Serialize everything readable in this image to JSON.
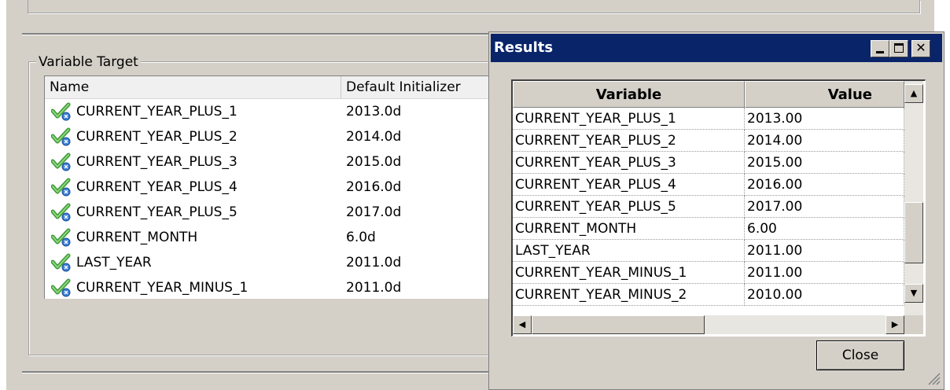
{
  "variable_target": {
    "title": "Variable Target",
    "columns": [
      "Name",
      "Default Initializer"
    ],
    "rows": [
      {
        "name": "CURRENT_YEAR_PLUS_1",
        "init": "2013.0d"
      },
      {
        "name": "CURRENT_YEAR_PLUS_2",
        "init": "2014.0d"
      },
      {
        "name": "CURRENT_YEAR_PLUS_3",
        "init": "2015.0d"
      },
      {
        "name": "CURRENT_YEAR_PLUS_4",
        "init": "2016.0d"
      },
      {
        "name": "CURRENT_YEAR_PLUS_5",
        "init": "2017.0d"
      },
      {
        "name": "CURRENT_MONTH",
        "init": "6.0d"
      },
      {
        "name": "LAST_YEAR",
        "init": "2011.0d"
      },
      {
        "name": "CURRENT_YEAR_MINUS_1",
        "init": "2011.0d"
      }
    ],
    "row_icon": "variable-check-icon"
  },
  "results": {
    "title": "Results",
    "columns": [
      "Variable",
      "Value"
    ],
    "rows": [
      {
        "variable": "CURRENT_YEAR_PLUS_1",
        "value": "2013.00"
      },
      {
        "variable": "CURRENT_YEAR_PLUS_2",
        "value": "2014.00"
      },
      {
        "variable": "CURRENT_YEAR_PLUS_3",
        "value": "2015.00"
      },
      {
        "variable": "CURRENT_YEAR_PLUS_4",
        "value": "2016.00"
      },
      {
        "variable": "CURRENT_YEAR_PLUS_5",
        "value": "2017.00"
      },
      {
        "variable": "CURRENT_MONTH",
        "value": "6.00"
      },
      {
        "variable": "LAST_YEAR",
        "value": "2011.00"
      },
      {
        "variable": "CURRENT_YEAR_MINUS_1",
        "value": "2011.00"
      },
      {
        "variable": "CURRENT_YEAR_MINUS_2",
        "value": "2010.00"
      }
    ],
    "close_label": "Close",
    "title_bar_color": "#0a246a"
  },
  "icons": {
    "minimize": "minimize-icon",
    "maximize": "maximize-icon",
    "close": "close-icon",
    "scroll_up": "arrow-up-icon",
    "scroll_down": "arrow-down-icon",
    "scroll_left": "arrow-left-icon",
    "scroll_right": "arrow-right-icon",
    "resize": "resize-grip-icon"
  }
}
